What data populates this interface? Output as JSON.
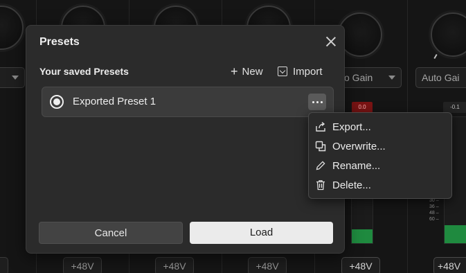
{
  "mixer": {
    "gain_selects": [
      "o Gain",
      "Auto Gai"
    ],
    "meter_readouts": [
      "0.0",
      "-0.1"
    ],
    "scale_marks": [
      "30 –",
      "36 –",
      "48 –",
      "60 –"
    ],
    "phantom_labels": [
      "+48V",
      "+48V",
      "+48V",
      "+48V",
      "+48V"
    ]
  },
  "dialog": {
    "title": "Presets",
    "close_icon": "close-icon",
    "saved_label": "Your saved Presets",
    "new_label": "New",
    "new_icon": "+",
    "import_label": "Import",
    "presets": [
      {
        "name": "Exported Preset 1",
        "selected": true
      }
    ],
    "cancel_label": "Cancel",
    "load_label": "Load"
  },
  "context_menu": {
    "items": [
      {
        "label": "Export...",
        "icon": "export-icon"
      },
      {
        "label": "Overwrite...",
        "icon": "overwrite-icon"
      },
      {
        "label": "Rename...",
        "icon": "pencil-icon"
      },
      {
        "label": "Delete...",
        "icon": "trash-icon"
      }
    ]
  },
  "colors": {
    "background": "#151515",
    "dialog": "#2b2b2b",
    "meter_green": "#1f8a3f",
    "clip_red": "#7a1414"
  }
}
